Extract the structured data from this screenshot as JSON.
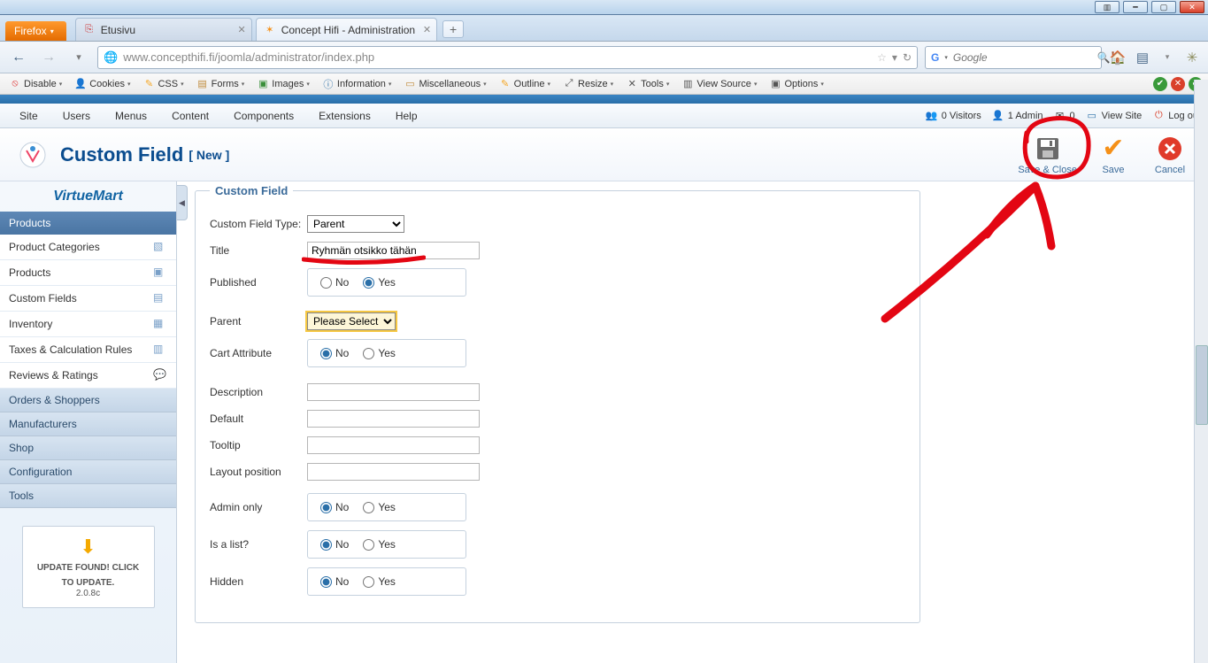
{
  "window": {
    "browser": "Firefox"
  },
  "tabs": [
    {
      "title": "Etusivu",
      "fav": "⎘",
      "favColor": "#c33",
      "active": false
    },
    {
      "title": "Concept Hifi - Administration",
      "fav": "✶",
      "favColor": "#f59018",
      "active": true
    }
  ],
  "url": "www.concepthifi.fi/joomla/administrator/index.php",
  "search": {
    "placeholder": "Google",
    "logo": "G"
  },
  "devtools": [
    {
      "icon": "⦸",
      "iconColor": "#d33",
      "label": "Disable"
    },
    {
      "icon": "👤",
      "iconColor": "#555",
      "label": "Cookies"
    },
    {
      "icon": "✎",
      "iconColor": "#f5a623",
      "label": "CSS"
    },
    {
      "icon": "▤",
      "iconColor": "#c08a3a",
      "label": "Forms"
    },
    {
      "icon": "▣",
      "iconColor": "#3a8f3a",
      "label": "Images"
    },
    {
      "icon": "ⓘ",
      "iconColor": "#2a6fa8",
      "label": "Information"
    },
    {
      "icon": "▭",
      "iconColor": "#c08a3a",
      "label": "Miscellaneous"
    },
    {
      "icon": "✎",
      "iconColor": "#f5a623",
      "label": "Outline"
    },
    {
      "icon": "⤢",
      "iconColor": "#555",
      "label": "Resize"
    },
    {
      "icon": "✕",
      "iconColor": "#555",
      "label": "Tools"
    },
    {
      "icon": "▥",
      "iconColor": "#555",
      "label": "View Source"
    },
    {
      "icon": "▣",
      "iconColor": "#555",
      "label": "Options"
    }
  ],
  "adminMenu": [
    "Site",
    "Users",
    "Menus",
    "Content",
    "Components",
    "Extensions",
    "Help"
  ],
  "adminRight": {
    "visitors": "0 Visitors",
    "admin": "1 Admin",
    "mail": "0",
    "viewSite": "View Site",
    "logout": "Log out"
  },
  "header": {
    "title": "Custom Field",
    "sub": "[ New ]"
  },
  "toolbar": {
    "saveClose": "Save & Close",
    "save": "Save",
    "cancel": "Cancel"
  },
  "sidebar": {
    "logo": "VirtueMart",
    "products": "Products",
    "links": [
      "Product Categories",
      "Products",
      "Custom Fields",
      "Inventory",
      "Taxes & Calculation Rules",
      "Reviews & Ratings"
    ],
    "cats": [
      "Orders & Shoppers",
      "Manufacturers",
      "Shop",
      "Configuration",
      "Tools"
    ],
    "update": {
      "line1": "UPDATE FOUND! CLICK",
      "line2": "TO UPDATE.",
      "version": "2.0.8c"
    }
  },
  "form": {
    "legend": "Custom Field",
    "typeLabel": "Custom Field Type:",
    "typeValue": "Parent",
    "titleLabel": "Title",
    "titleValue": "Ryhmän otsikko tähän",
    "publishedLabel": "Published",
    "parentLabel": "Parent",
    "parentValue": "Please Select",
    "cartAttrLabel": "Cart Attribute",
    "descriptionLabel": "Description",
    "defaultLabel": "Default",
    "tooltipLabel": "Tooltip",
    "layoutLabel": "Layout position",
    "adminOnlyLabel": "Admin only",
    "isListLabel": "Is a list?",
    "hiddenLabel": "Hidden",
    "no": "No",
    "yes": "Yes"
  }
}
